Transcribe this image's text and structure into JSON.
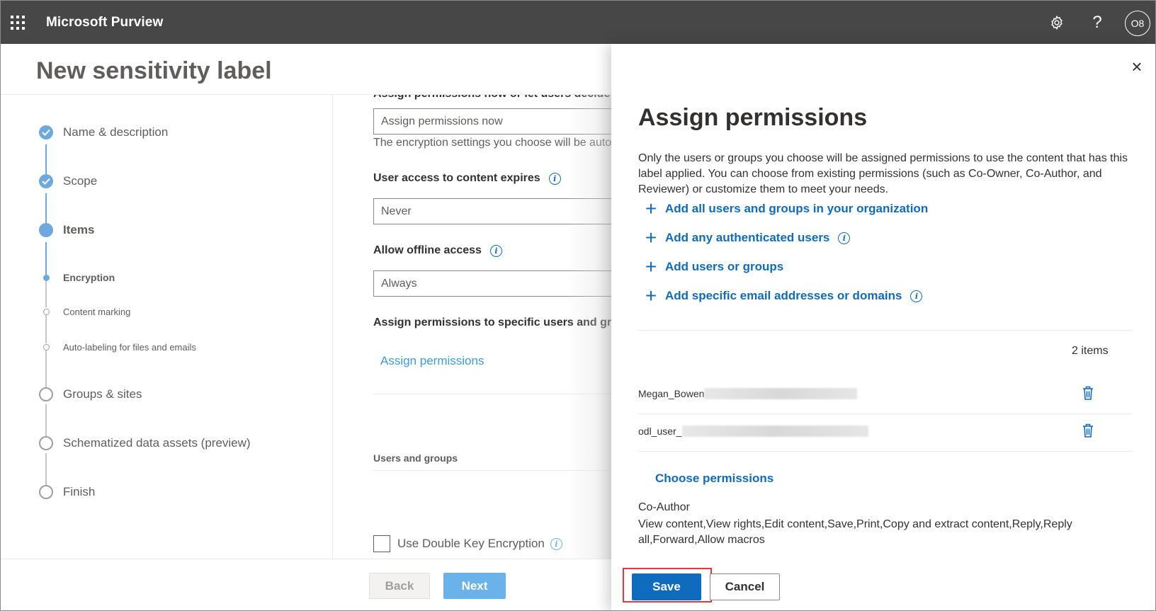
{
  "app": {
    "title": "Microsoft Purview",
    "avatar_initials": "O8",
    "help_glyph": "?"
  },
  "page": {
    "title": "New sensitivity label"
  },
  "wizard": {
    "steps": [
      {
        "label": "Name & description",
        "state": "done"
      },
      {
        "label": "Scope",
        "state": "done"
      },
      {
        "label": "Items",
        "state": "current"
      },
      {
        "label": "Encryption",
        "state": "current-sub"
      },
      {
        "label": "Content marking",
        "state": "sub"
      },
      {
        "label": "Auto-labeling for files and emails",
        "state": "sub"
      },
      {
        "label": "Groups & sites",
        "state": "todo"
      },
      {
        "label": "Schematized data assets (preview)",
        "state": "todo"
      },
      {
        "label": "Finish",
        "state": "todo"
      }
    ]
  },
  "form": {
    "assign_now_label_cut": "Assign permissions now or let users decide?",
    "assign_now_value": "Assign permissions now",
    "encryption_help": "The encryption settings you choose will be automatically enforced",
    "expires_label": "User access to content expires",
    "expires_value": "Never",
    "offline_label": "Allow offline access",
    "offline_value": "Always",
    "specific_label": "Assign permissions to specific users and groups",
    "assign_link": "Assign permissions",
    "users_groups_head": "Users and groups",
    "double_key_label": "Use Double Key Encryption"
  },
  "footer": {
    "back": "Back",
    "next": "Next"
  },
  "panel": {
    "title": "Assign permissions",
    "description": "Only the users or groups you choose will be assigned permissions to use the content that has this label applied. You can choose from existing permissions (such as Co-Owner, Co-Author, and Reviewer) or customize them to meet your needs.",
    "add_options": [
      {
        "label": "Add all users and groups in your organization",
        "info": false
      },
      {
        "label": "Add any authenticated users",
        "info": true
      },
      {
        "label": "Add users or groups",
        "info": false
      },
      {
        "label": "Add specific email addresses or domains",
        "info": true
      }
    ],
    "items_count": "2 items",
    "users": [
      {
        "name": "Megan_Bowen"
      },
      {
        "name": "odl_user_"
      }
    ],
    "choose_permissions": "Choose permissions",
    "role": "Co-Author",
    "permissions": "View content,View rights,Edit content,Save,Print,Copy and extract content,Reply,Reply all,Forward,Allow macros",
    "save": "Save",
    "cancel": "Cancel",
    "close_glyph": "×"
  },
  "colors": {
    "topbar": "#474747",
    "accent": "#0f6cbd",
    "step_blue": "#6ea9dd",
    "highlight": "#e0393e"
  }
}
